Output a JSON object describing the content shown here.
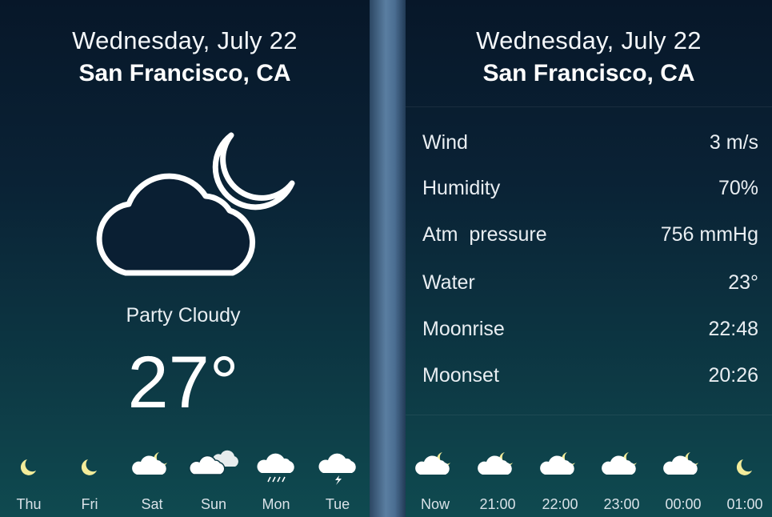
{
  "left_panel": {
    "date": "Wednesday, July 22",
    "city": "San Francisco, CA",
    "condition": "Party Cloudy",
    "temperature": "27°",
    "main_icon": "cloud-moon-icon",
    "forecast": [
      {
        "label": "Thu",
        "icon": "moon-icon"
      },
      {
        "label": "Fri",
        "icon": "moon-icon"
      },
      {
        "label": "Sat",
        "icon": "cloud-moon-icon"
      },
      {
        "label": "Sun",
        "icon": "clouds-icon"
      },
      {
        "label": "Mon",
        "icon": "cloud-rain-icon"
      },
      {
        "label": "Tue",
        "icon": "cloud-lightning-icon"
      }
    ]
  },
  "right_panel": {
    "date": "Wednesday, July 22",
    "city": "San Francisco, CA",
    "details": [
      {
        "label": "Wind",
        "value": "3 m/s"
      },
      {
        "label": "Humidity",
        "value": "70%"
      },
      {
        "label": "Atm  pressure",
        "value": "756 mmHg"
      },
      {
        "label": "Water",
        "value": "23°"
      },
      {
        "label": "Moonrise",
        "value": "22:48"
      },
      {
        "label": "Moonset",
        "value": "20:26"
      }
    ],
    "hourly": [
      {
        "label": "Now",
        "icon": "cloud-moon-icon"
      },
      {
        "label": "21:00",
        "icon": "cloud-moon-icon"
      },
      {
        "label": "22:00",
        "icon": "cloud-moon-icon"
      },
      {
        "label": "23:00",
        "icon": "cloud-moon-icon"
      },
      {
        "label": "00:00",
        "icon": "cloud-moon-icon"
      },
      {
        "label": "01:00",
        "icon": "moon-icon"
      }
    ]
  },
  "colors": {
    "moon_accent": "#f3ec9a",
    "cloud": "#ffffff",
    "panel_top": "#071729",
    "panel_bottom": "#0f4a50"
  }
}
